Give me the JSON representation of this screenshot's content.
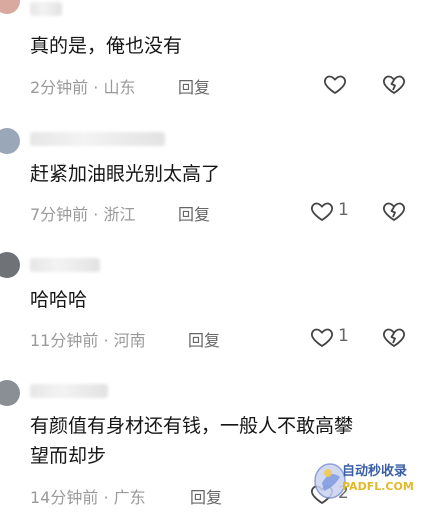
{
  "comments": [
    {
      "text": "真的是，俺也没有",
      "meta": "2分钟前 · 山东",
      "reply": "回复",
      "likes": ""
    },
    {
      "text": "赶紧加油眼光别太高了",
      "meta": "7分钟前 · 浙江",
      "reply": "回复",
      "likes": "1"
    },
    {
      "text": "哈哈哈",
      "meta": "11分钟前 · 河南",
      "reply": "回复",
      "likes": "1"
    },
    {
      "text_line1": "有颜值有身材还有钱，一般人不敢高攀",
      "text_line2": "望而却步",
      "meta": "14分钟前 · 广东",
      "reply": "回复",
      "likes": "2"
    }
  ],
  "watermark": {
    "line1": "自动秒收录",
    "line2": "PADFL.COM"
  },
  "icons": {
    "like": "heart-outline-icon",
    "dislike": "broken-heart-icon"
  }
}
